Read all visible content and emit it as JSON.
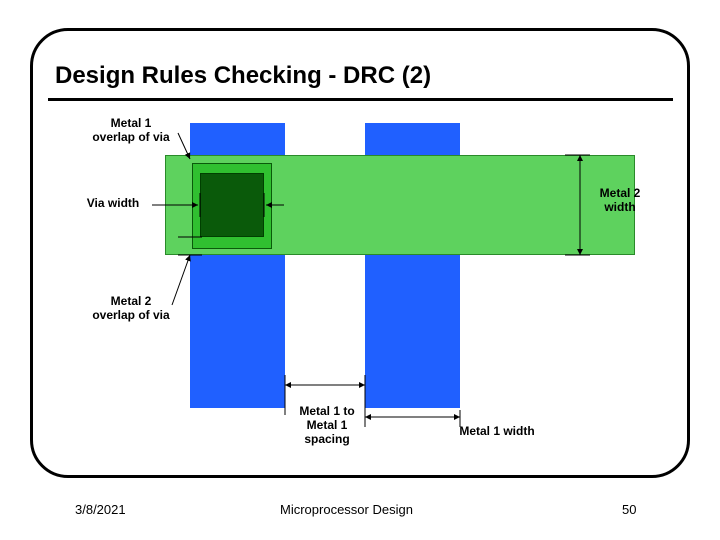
{
  "slide": {
    "title": "Design Rules Checking - DRC (2)",
    "date": "3/8/2021",
    "footer_title": "Microprocessor Design",
    "page": "50"
  },
  "labels": {
    "metal1_overlap": "Metal 1\noverlap of via",
    "via_width": "Via width",
    "metal2_overlap": "Metal 2\noverlap of via",
    "metal2_width": "Metal 2\nwidth",
    "metal1_spacing": "Metal 1 to\nMetal 1\nspacing",
    "metal1_width": "Metal 1 width"
  },
  "colors": {
    "metal1": "#2060ff",
    "metal2": "#5ed25e",
    "via": "#0a5a0a"
  }
}
